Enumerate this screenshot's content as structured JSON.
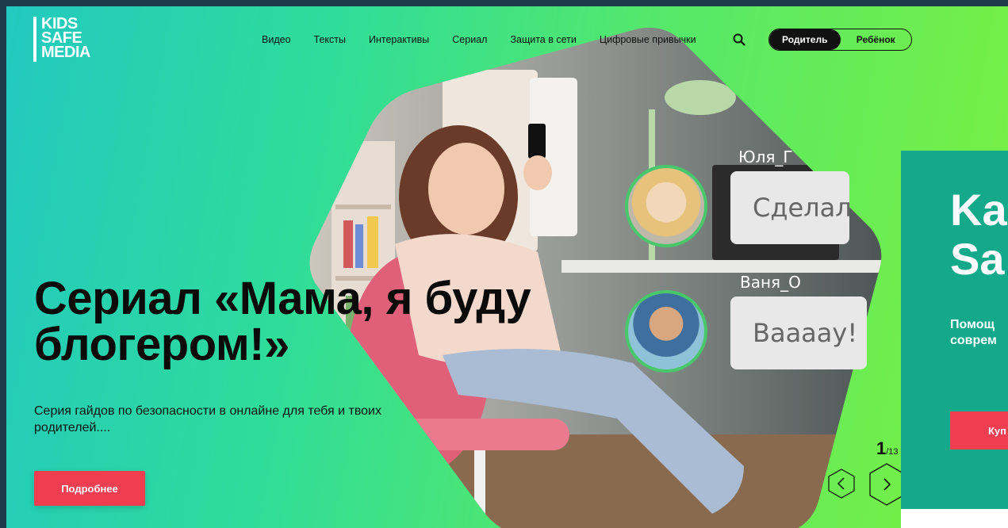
{
  "logo": {
    "line1": "KIDS",
    "line2": "SAFE",
    "line3": "MEDIA"
  },
  "nav": {
    "items": [
      "Видео",
      "Тексты",
      "Интерактивы",
      "Сериал",
      "Защита в сети",
      "Цифровые привычки"
    ]
  },
  "role_toggle": {
    "parent": "Родитель",
    "child": "Ребёнок",
    "active": "parent"
  },
  "hero": {
    "title_line1": "Сериал «Мама, я буду",
    "title_line2": "блогером!»",
    "description_line1": "Серия гайдов по безопасности в онлайне для тебя и твоих",
    "description_line2": "родителей....",
    "button": "Подробнее"
  },
  "chat": {
    "msg1_name": "Юля_Г",
    "msg1_text": "Сделал",
    "msg2_name": "Ваня_О",
    "msg2_text": "Вааааy!"
  },
  "slider": {
    "current": "1",
    "total": "/13"
  },
  "next_slide": {
    "title_line1": "Ka",
    "title_line2": "Sa",
    "desc_line1": "Помощ",
    "desc_line2": "соврем",
    "button": "Куп"
  },
  "colors": {
    "accent_red": "#f03e51",
    "gradient_start": "#22c9c0",
    "gradient_end": "#7cf040",
    "card_teal": "#14a98b"
  },
  "icons": [
    "search-icon",
    "chevron-left-icon",
    "chevron-right-icon"
  ]
}
